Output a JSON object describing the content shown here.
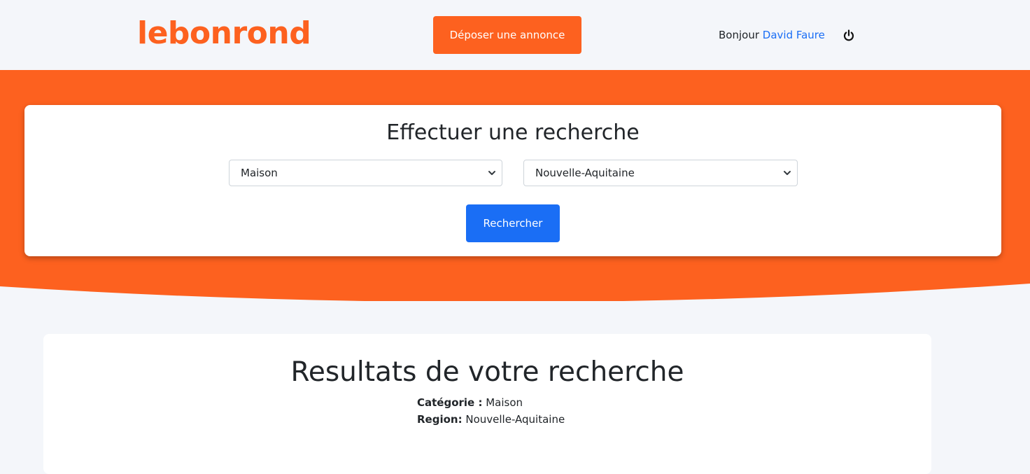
{
  "header": {
    "logo": "lebonrond",
    "post_button": "Déposer une annonce",
    "greeting": "Bonjour",
    "user_name": "David Faure",
    "logout_icon": "power-icon"
  },
  "search": {
    "title": "Effectuer une recherche",
    "category_selected": "Maison",
    "region_selected": "Nouvelle-Aquitaine",
    "button": "Rechercher"
  },
  "results": {
    "title": "Resultats de votre recherche",
    "category_label": "Catégorie :",
    "category_value": "Maison",
    "region_label": "Region:",
    "region_value": "Nouvelle-Aquitaine"
  },
  "colors": {
    "brand_orange": "#fd611f",
    "primary_blue": "#1a6ef5",
    "background": "#f4f6fa"
  }
}
